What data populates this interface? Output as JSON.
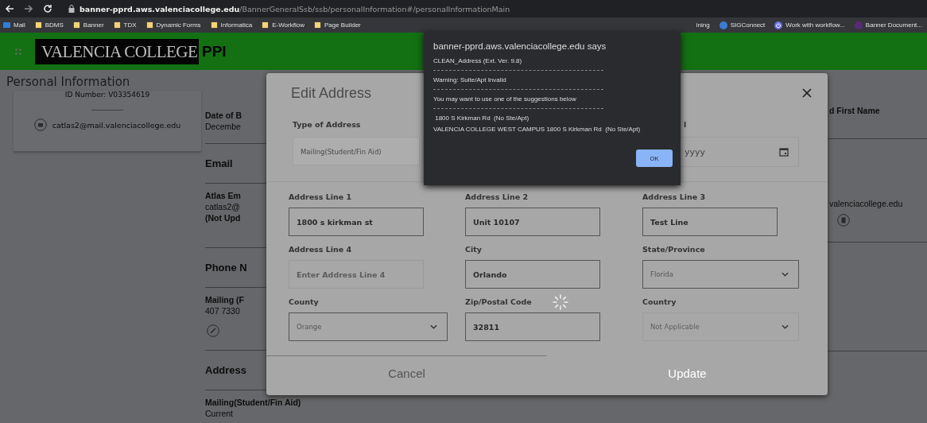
{
  "browser": {
    "url_host": "banner-pprd.aws.valenciacollege.edu",
    "url_path": "/BannerGeneralSsb/ssb/personalInformation#/personalInformationMain",
    "bookmarks": [
      {
        "label": "Mail",
        "kind": "mail",
        "color": "#2f7fd8"
      },
      {
        "label": "BDMS",
        "kind": "folder",
        "color": "#f2d374"
      },
      {
        "label": "Banner",
        "kind": "folder",
        "color": "#f2d374"
      },
      {
        "label": "TDX",
        "kind": "folder",
        "color": "#f2d374"
      },
      {
        "label": "Dynamic Forms",
        "kind": "folder",
        "color": "#f2d374"
      },
      {
        "label": "Informatica",
        "kind": "folder",
        "color": "#f2d374"
      },
      {
        "label": "E-Workflow",
        "kind": "folder",
        "color": "#f2d374"
      },
      {
        "label": "Page Builder",
        "kind": "folder",
        "color": "#f2d374"
      }
    ],
    "bookmarks_right": [
      {
        "label": "ining",
        "kind": "text"
      },
      {
        "label": "SIGConnect",
        "kind": "globe",
        "color": "#3a7bd5"
      },
      {
        "label": "Work with workflow...",
        "kind": "power",
        "color": "#6a6ef0"
      },
      {
        "label": "Banner Document...",
        "kind": "globe",
        "color": "#5a2a7a"
      }
    ]
  },
  "header": {
    "logo": "VALENCIA COLLEGE",
    "app": "PPI"
  },
  "page": {
    "title": "Personal Information",
    "id_number": "ID Number: V03354619",
    "email": "catlas2@mail.valenciacollege.edu",
    "sections": [
      {
        "rows": [
          {
            "kind": "label",
            "text": "Date of B"
          },
          {
            "kind": "value",
            "text": "Decembe"
          }
        ]
      },
      {
        "heading": "Email",
        "rows": [
          {
            "kind": "label",
            "text": "Atlas Em"
          },
          {
            "kind": "value",
            "text": "catlas2@"
          },
          {
            "kind": "label",
            "text": "(Not Upd"
          }
        ]
      },
      {
        "heading": "Phone N",
        "rows": [
          {
            "kind": "label",
            "text": "Mailing (F"
          },
          {
            "kind": "value",
            "text": "407 7330"
          },
          {
            "kind": "edit"
          }
        ]
      },
      {
        "heading": "Address",
        "rows": [
          {
            "kind": "label",
            "text": "Mailing(Student/Fin Aid)"
          },
          {
            "kind": "value",
            "text": "Current"
          }
        ]
      }
    ],
    "right_label": "d First Name",
    "right_email": "valenciacollege.edu"
  },
  "modal": {
    "title": "Edit Address",
    "type_field": {
      "label": "Type of Address",
      "value": "Mailing(Student/Fin Aid)",
      "disabled": true
    },
    "date_field": {
      "label": "l",
      "value": "yyyy"
    },
    "fields": [
      {
        "label": "Address Line 1",
        "kind": "input",
        "value": "1800 s kirkman st",
        "disabled": false
      },
      {
        "label": "Address Line 2",
        "kind": "input",
        "value": "Unit 10107",
        "disabled": false
      },
      {
        "label": "Address Line 3",
        "kind": "input",
        "value": "Test Line",
        "disabled": false
      },
      {
        "label": "Address Line 4",
        "kind": "input",
        "placeholder": "Enter Address Line 4",
        "disabled": false
      },
      {
        "label": "City",
        "kind": "input",
        "value": "Orlando",
        "disabled": false
      },
      {
        "label": "State/Province",
        "kind": "select",
        "value": "Florida",
        "disabled": false
      },
      {
        "label": "County",
        "kind": "select",
        "value": "Orange",
        "disabled": false
      },
      {
        "label": "Zip/Postal Code",
        "kind": "input",
        "value": "32811",
        "disabled": false,
        "loading": true
      },
      {
        "label": "Country",
        "kind": "select",
        "value": "Not Applicable",
        "disabled": true
      }
    ],
    "buttons": [
      {
        "label": "Cancel",
        "disabled": false
      },
      {
        "label": "Update",
        "disabled": true
      }
    ]
  },
  "alert": {
    "title": "banner-pprd.aws.valenciacollege.edu says",
    "blocks": [
      [
        "CLEAN_Address (Ext. Ver. 9.8)"
      ],
      [
        "Warning: Suite/Apt Invalid"
      ],
      [
        "You may want to use one of the suggestions below"
      ],
      [
        " 1800 S Kirkman Rd  (No Ste/Apt)",
        "VALENCIA COLLEGE WEST CAMPUS 1800 S Kirkman Rd  (No Ste/Apt)"
      ]
    ],
    "button": "OK"
  }
}
